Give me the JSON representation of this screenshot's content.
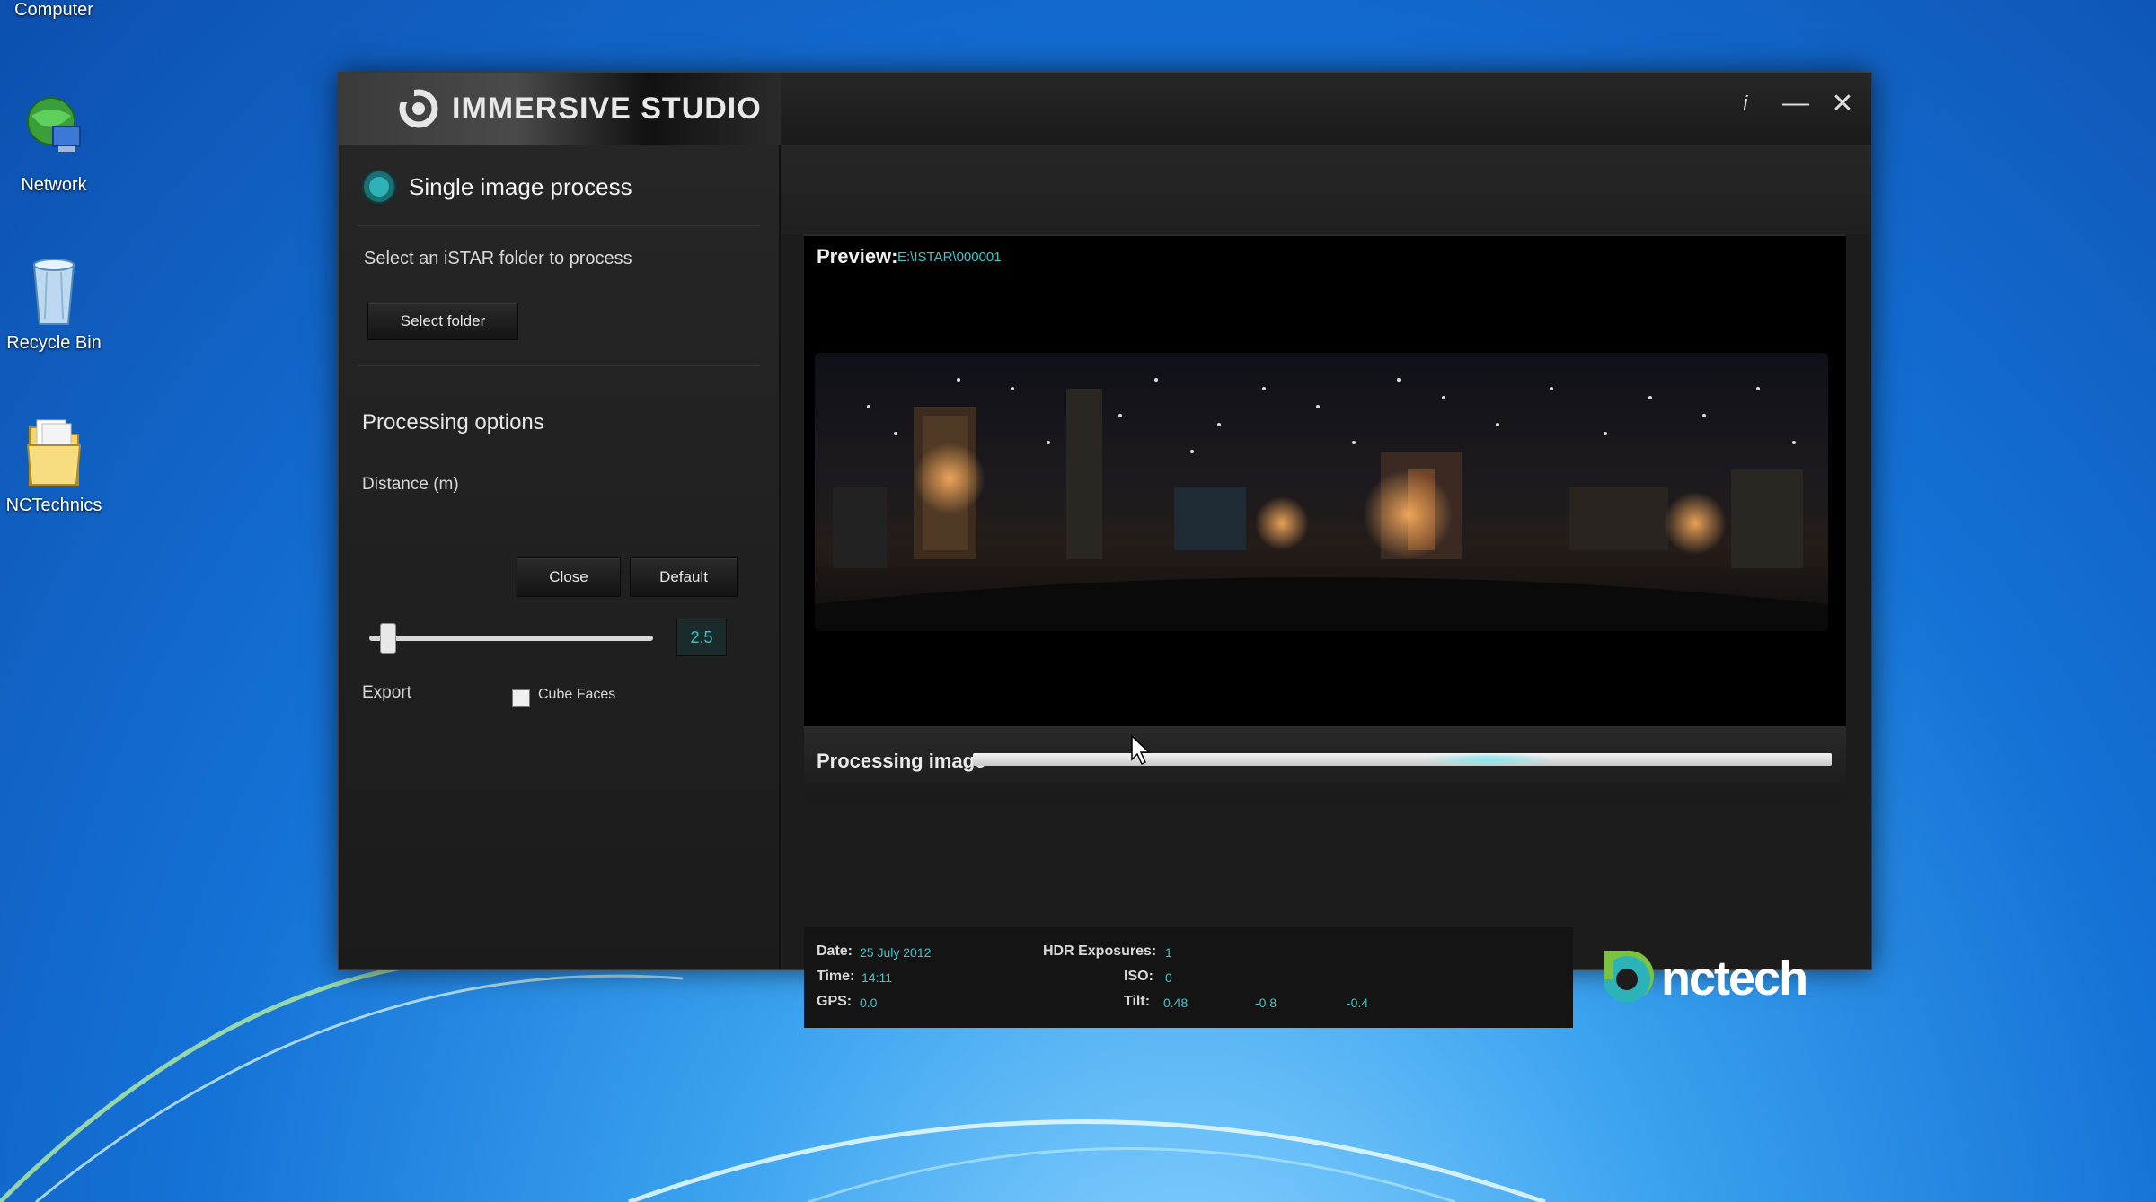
{
  "desktop": {
    "icons": [
      {
        "label": "Computer"
      },
      {
        "label": "Network"
      },
      {
        "label": "Recycle Bin"
      },
      {
        "label": "NCTechnics"
      }
    ]
  },
  "window": {
    "title": "IMMERSIVE STUDIO",
    "controls": {
      "info": "i",
      "minimize": "—",
      "close": "✕"
    }
  },
  "sidebar": {
    "mode_label": "Single image process",
    "select_prompt": "Select an iSTAR folder to process",
    "select_button": "Select folder",
    "processing_options_title": "Processing options",
    "distance_label": "Distance (m)",
    "close_button": "Close",
    "default_button": "Default",
    "distance_value": "2.5",
    "export_label": "Export",
    "cube_faces_label": "Cube Faces",
    "cube_faces_checked": false
  },
  "preview": {
    "label": "Preview:",
    "path": "E:\\ISTAR\\000001"
  },
  "progress": {
    "label": "Processing image",
    "value_pct": 60
  },
  "info": {
    "date_label": "Date:",
    "date_value": "25 July 2012",
    "time_label": "Time:",
    "time_value": "14:11",
    "gps_label": "GPS:",
    "gps_value": "0.0",
    "hdr_label": "HDR Exposures:",
    "hdr_value": "1",
    "iso_label": "ISO:",
    "iso_value": "0",
    "tilt_label": "Tilt:",
    "tilt_values": [
      "0.48",
      "-0.8",
      "-0.4"
    ]
  },
  "brand": {
    "name": "nctech",
    "accent": "#2bb3b8"
  }
}
